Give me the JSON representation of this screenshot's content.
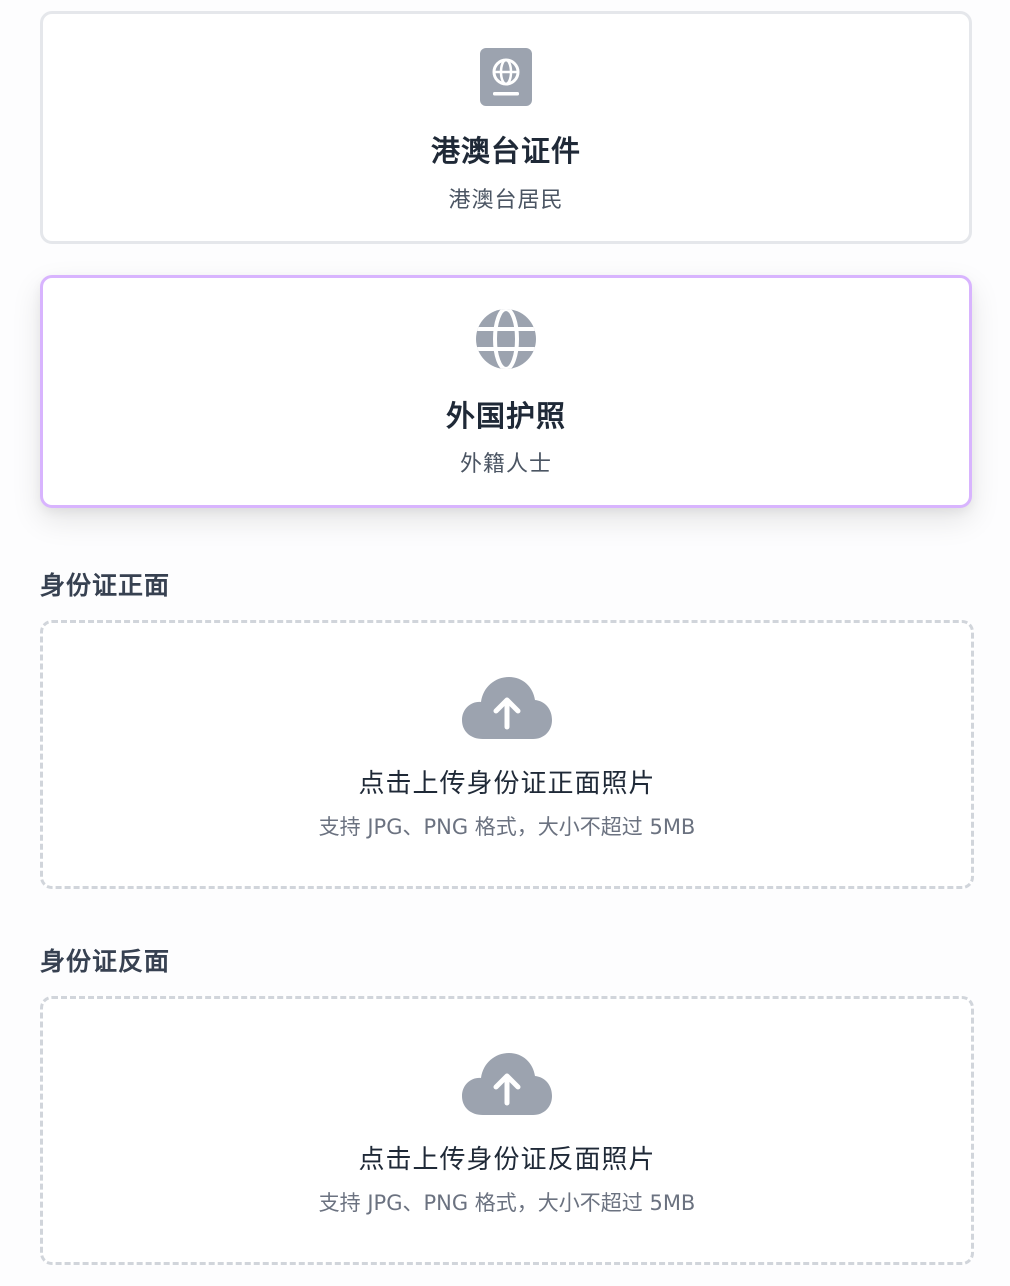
{
  "document_types": [
    {
      "icon": "passport-icon",
      "title": "港澳台证件",
      "subtitle": "港澳台居民",
      "selected": false
    },
    {
      "icon": "globe-icon",
      "title": "外国护照",
      "subtitle": "外籍人士",
      "selected": true
    }
  ],
  "uploads": {
    "front": {
      "label": "身份证正面",
      "title": "点击上传身份证正面照片",
      "hint": "支持 JPG、PNG 格式，大小不超过 5MB",
      "icon": "cloud-upload-icon"
    },
    "back": {
      "label": "身份证反面",
      "title": "点击上传身份证反面照片",
      "hint": "支持 JPG、PNG 格式，大小不超过 5MB",
      "icon": "cloud-upload-icon"
    }
  },
  "colors": {
    "selected_border": "#d8b4fe",
    "icon_gray": "#9ca3af",
    "dashed_border": "#d1d5db"
  }
}
